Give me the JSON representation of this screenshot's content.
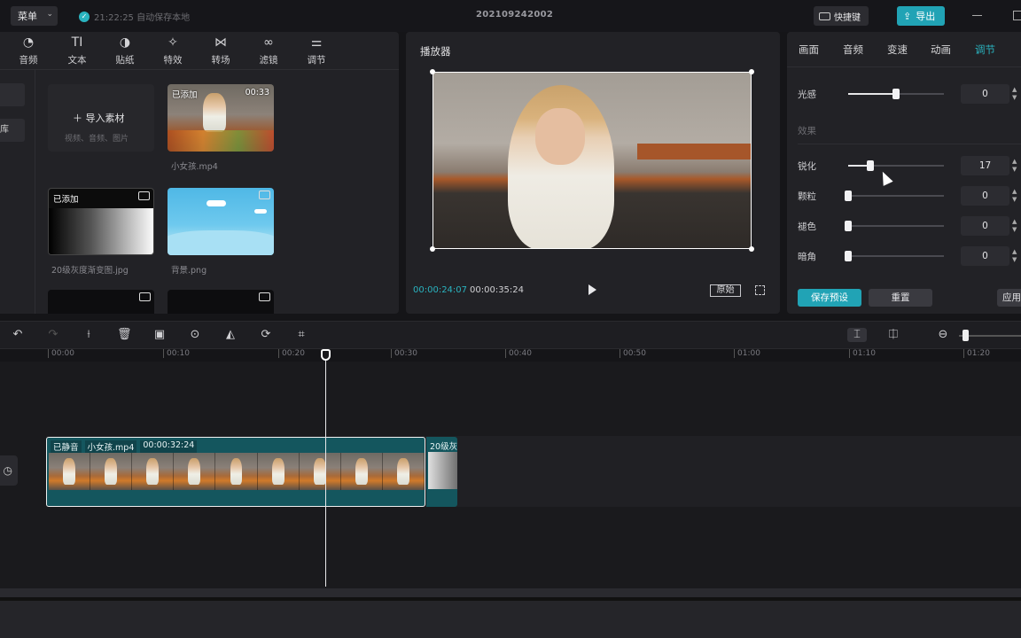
{
  "titlebar": {
    "menu_label": "菜单",
    "autosave_text": "21:22:25 自动保存本地",
    "project_title": "202109242002",
    "shortcut_label": "快捷键",
    "export_label": "导出"
  },
  "tool_tabs": [
    {
      "label": "音频",
      "icon": "audio-icon"
    },
    {
      "label": "文本",
      "icon": "text-icon"
    },
    {
      "label": "贴纸",
      "icon": "sticker-icon"
    },
    {
      "label": "特效",
      "icon": "effects-icon"
    },
    {
      "label": "转场",
      "icon": "transition-icon"
    },
    {
      "label": "滤镜",
      "icon": "filter-icon"
    },
    {
      "label": "调节",
      "icon": "adjust-icon"
    }
  ],
  "side_strip": {
    "item2": "库"
  },
  "media": {
    "import_label": "导入素材",
    "import_hint": "视频、音频、图片",
    "items": [
      {
        "name": "小女孩.mp4",
        "tag": "已添加",
        "duration": "00:33"
      },
      {
        "name": "20级灰度渐变图.jpg",
        "tag": "已添加"
      },
      {
        "name": "背景.png"
      }
    ]
  },
  "player": {
    "title": "播放器",
    "current_time": "00:00:24:07",
    "total_time": "00:00:35:24",
    "original_label": "原始"
  },
  "adjust": {
    "tabs": [
      "画面",
      "音频",
      "变速",
      "动画",
      "调节"
    ],
    "active_tab": "调节",
    "section_effects": "效果",
    "rows": [
      {
        "label": "光感",
        "value": "0",
        "level": 0.5
      },
      {
        "label": "锐化",
        "value": "17",
        "level": 0.23
      },
      {
        "label": "颗粒",
        "value": "0",
        "level": 0.0
      },
      {
        "label": "褪色",
        "value": "0",
        "level": 0.0
      },
      {
        "label": "暗角",
        "value": "0",
        "level": 0.0
      }
    ],
    "save_preset_label": "保存预设",
    "reset_label": "重置",
    "apply_label": "应用"
  },
  "timeline": {
    "ruler": [
      "00:00",
      "00:10",
      "00:20",
      "00:30",
      "00:40",
      "00:50",
      "01:00",
      "01:10",
      "01:20"
    ],
    "clip_main": {
      "muted_tag": "已静音",
      "name": "小女孩.mp4",
      "duration": "00:00:32:24"
    },
    "clip_second": {
      "name": "20级灰"
    }
  },
  "colors": {
    "accent": "#21a3b5",
    "clip": "#14565e"
  }
}
